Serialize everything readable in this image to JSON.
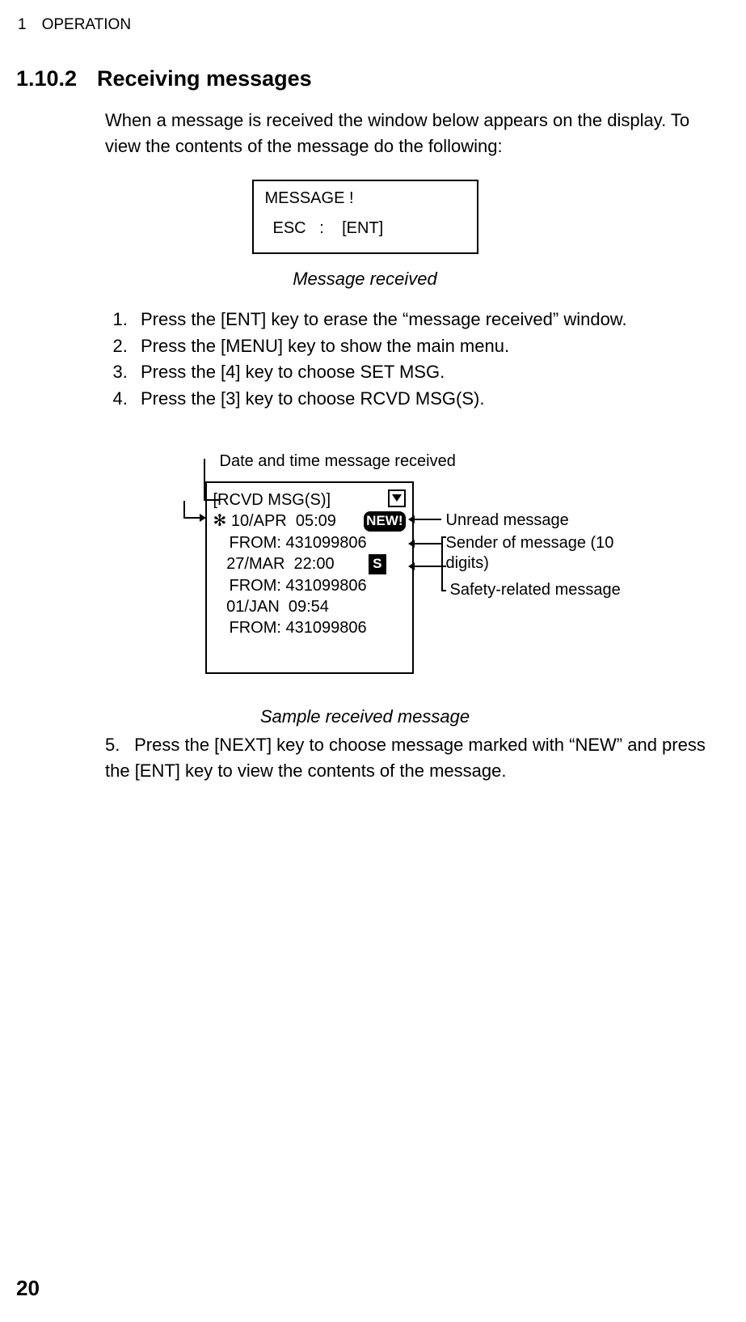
{
  "chapter_header": "1 OPERATION",
  "section_number": "1.10.2",
  "section_title": "Receiving messages",
  "intro_text": "When a message is received the window below appears on the display. To view the contents of the message do the following:",
  "msg_box": {
    "line1": "MESSAGE !",
    "line2": "ESC   :    [ENT]"
  },
  "figure1_caption": "Message received",
  "steps": [
    "Press the [ENT] key to erase the “message received” window.",
    "Press the [MENU] key to show the main menu.",
    "Press the [4] key to choose SET MSG.",
    "Press the [3] key to choose RCVD MSG(S)."
  ],
  "diagram_top_label": "Date and time message received",
  "rcvd": {
    "title": "[RCVD MSG(S)]",
    "entries": [
      {
        "line1": "✻ 10/APR  05:09",
        "from": "FROM: 431099806",
        "new": "NEW!"
      },
      {
        "line1": "   27/MAR  22:00",
        "from": "FROM: 431099806",
        "s": "S"
      },
      {
        "line1": "   01/JAN  09:54",
        "from": "FROM: 431099806"
      }
    ]
  },
  "annotations": {
    "unread": "Unread message",
    "sender": "Sender of message (10 digits)",
    "safety": "Safety-related message"
  },
  "figure2_caption": "Sample received message",
  "step5": "Press the [NEXT] key to choose message marked with “NEW” and press the [ENT] key to view the contents of the message.",
  "page_number": "20"
}
